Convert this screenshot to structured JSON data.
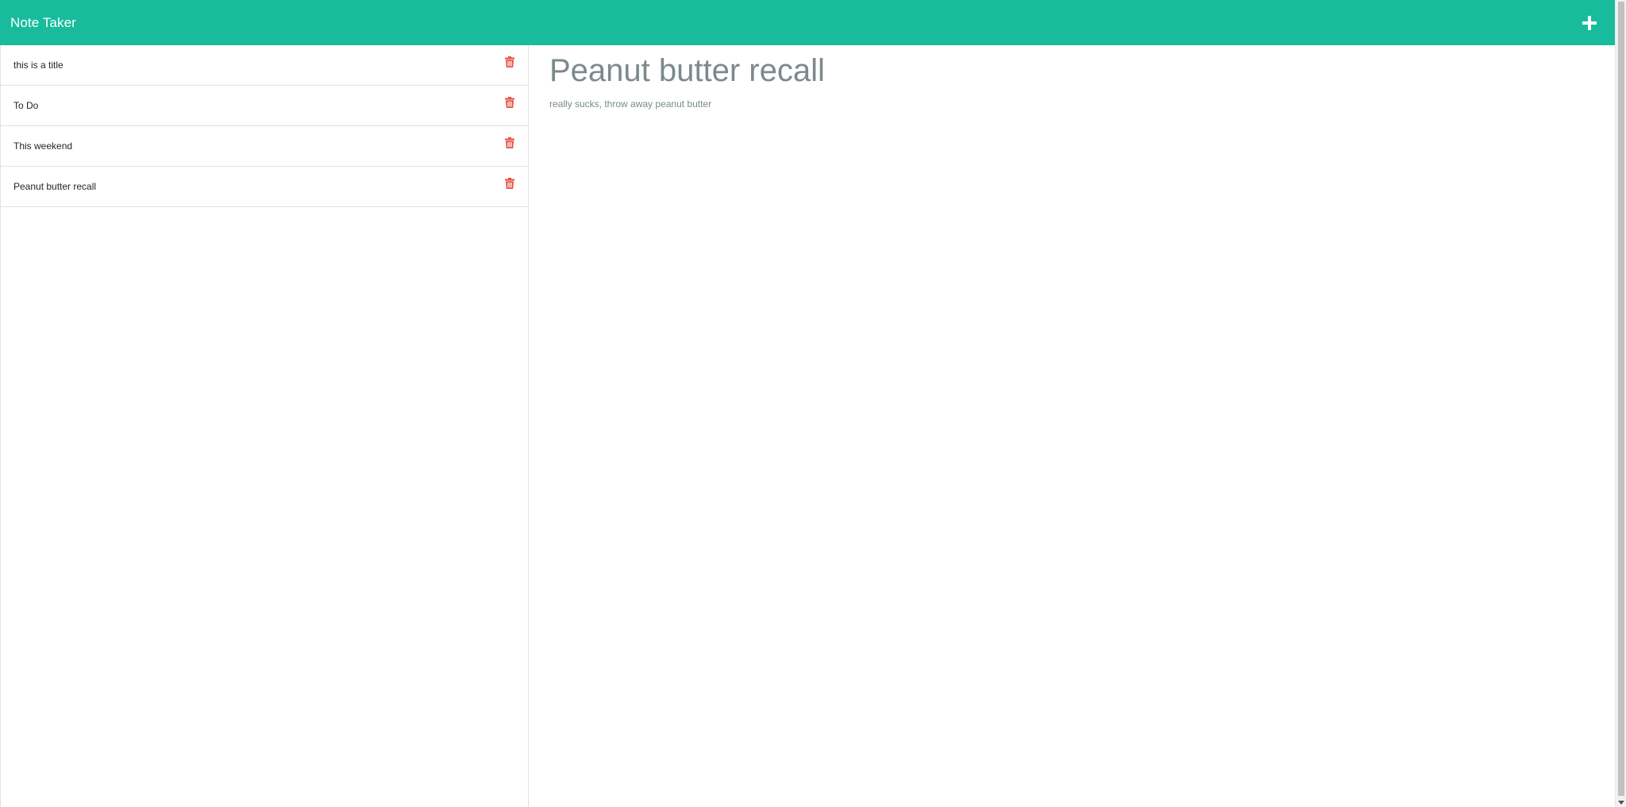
{
  "app": {
    "title": "Note Taker"
  },
  "colors": {
    "navbar": "#18bc9c",
    "delete_icon": "#e74c3c",
    "note_text": "#7b8a8b"
  },
  "header": {
    "new_note_icon": "plus-icon"
  },
  "notes": [
    {
      "title": "this is a title",
      "delete_icon": "trash-icon"
    },
    {
      "title": "To Do",
      "delete_icon": "trash-icon"
    },
    {
      "title": "This weekend",
      "delete_icon": "trash-icon"
    },
    {
      "title": "Peanut butter recall",
      "delete_icon": "trash-icon"
    }
  ],
  "active_note": {
    "title": "Peanut butter recall",
    "text": "really sucks, throw away peanut butter"
  }
}
